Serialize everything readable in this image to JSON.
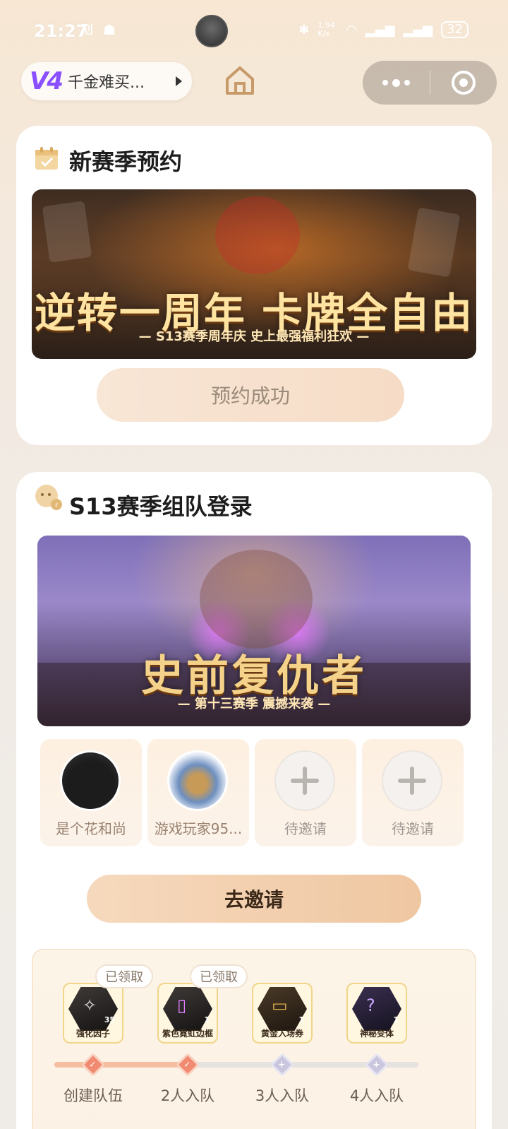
{
  "status_bar": {
    "time": "21:27",
    "left_icons": "₪ ☗",
    "speed": "1.94 K/s",
    "battery": "32"
  },
  "top_nav": {
    "level_badge": "V4",
    "level_name": "千金难买...",
    "home_icon": "home-icon",
    "more_icon": "more-icon",
    "close_icon": "close-icon"
  },
  "card1": {
    "title": "新赛季预约",
    "banner_title": "逆转一周年 卡牌全自由",
    "banner_sub": "— S13赛季周年庆  史上最强福利狂欢 —",
    "button_label": "预约成功"
  },
  "card2": {
    "title": "S13赛季组队登录",
    "banner_title": "史前复仇者",
    "banner_sub": "— 第十三赛季  震撼来袭 —",
    "slots": [
      {
        "name": "是个花和尚",
        "filled": true
      },
      {
        "name": "游戏玩家95...",
        "filled": true
      },
      {
        "name": "待邀请",
        "filled": false
      },
      {
        "name": "待邀请",
        "filled": false
      }
    ],
    "invite_button": "去邀请",
    "rewards": [
      {
        "name": "强化因子",
        "count": "35",
        "claimed_label": "已领取"
      },
      {
        "name": "紫色霓虹边框",
        "count": "1",
        "claimed_label": "已领取"
      },
      {
        "name": "黄金入场券",
        "count": "1",
        "claimed_label": ""
      },
      {
        "name": "神秘变体",
        "count": "1",
        "claimed_label": ""
      }
    ],
    "stages": [
      "创建队伍",
      "2人入队",
      "3人入队",
      "4人入队"
    ],
    "stages_completed": 2
  },
  "colors": {
    "accent": "#f08a70",
    "card_bg": "#ffffff",
    "page_bg": "#f3e9dd"
  }
}
